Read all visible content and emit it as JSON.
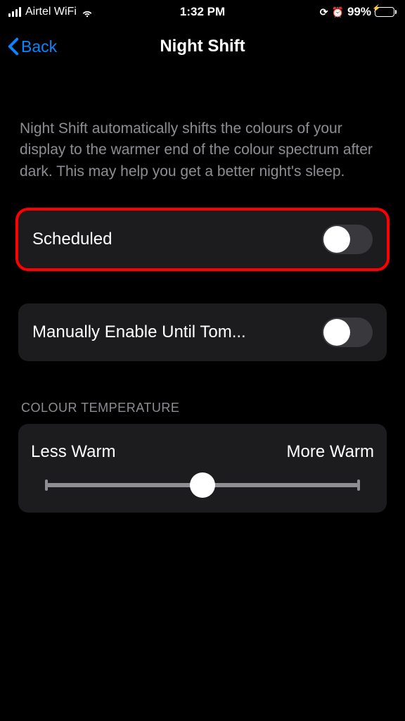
{
  "status": {
    "carrier": "Airtel WiFi",
    "time": "1:32 PM",
    "battery_pct": "99%"
  },
  "nav": {
    "back_label": "Back",
    "title": "Night Shift"
  },
  "description": "Night Shift automatically shifts the colours of your display to the warmer end of the colour spectrum after dark. This may help you get a better night's sleep.",
  "rows": {
    "scheduled_label": "Scheduled",
    "manual_label": "Manually Enable Until Tom..."
  },
  "temperature": {
    "section_header": "COLOUR TEMPERATURE",
    "min_label": "Less Warm",
    "max_label": "More Warm"
  }
}
